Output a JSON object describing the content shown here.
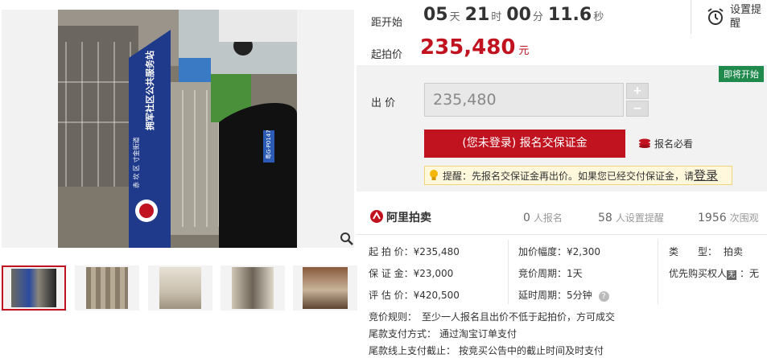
{
  "gallery": {
    "thumbnails": [
      "thumb-1",
      "thumb-2",
      "thumb-3",
      "thumb-4",
      "thumb-5"
    ],
    "zoom_icon": "magnifier-icon",
    "photo_sign_top": "拥军社区公共服务站",
    "photo_sign_left": "赤 坎 区 寸金街道",
    "photo_plate": "粤G·P0147"
  },
  "countdown": {
    "label": "距开始",
    "days": "05",
    "days_unit": "天",
    "hours": "21",
    "hours_unit": "时",
    "minutes": "00",
    "minutes_unit": "分",
    "seconds": "11.6",
    "seconds_unit": "秒"
  },
  "remind": {
    "label": "设置提醒",
    "icon": "alarm-clock-icon"
  },
  "start_price": {
    "label": "起拍价",
    "value": "235,480",
    "unit": "元"
  },
  "bid": {
    "label": "出 价",
    "value": "235,480",
    "plus": "+",
    "minus": "−",
    "status_badge": "即将开始",
    "pay_button": "(您未登录) 报名交保证金",
    "must_read": "报名必看",
    "notice_text": "提醒：先报名交保证金再出价。如果您已经交付保证金，请",
    "notice_login": "登录"
  },
  "stats": {
    "platform": "阿里拍卖",
    "signups_n": "0",
    "signups_label": "人报名",
    "reminders_n": "58",
    "reminders_label": "人设置提醒",
    "views_n": "1956",
    "views_label": "次围观"
  },
  "details": {
    "start_price": {
      "k": "起 拍 价：",
      "v": "¥235,480"
    },
    "deposit": {
      "k": "保 证 金：",
      "v": "¥23,000"
    },
    "appraisal": {
      "k": "评 估 价：",
      "v": "¥420,500"
    },
    "increment": {
      "k": "加价幅度：",
      "v": "¥2,300"
    },
    "cycle": {
      "k": "竞价周期：",
      "v": "1天"
    },
    "delay": {
      "k": "延时周期：",
      "v": "5分钟"
    },
    "type": {
      "k": "类　　型：",
      "v": "拍卖"
    },
    "priority": {
      "k": "优先购买权人",
      "badge": "无",
      "v": "：无"
    },
    "rule": {
      "k": "竞价规则：",
      "v": "至少一人报名且出价不低于起拍价，方可成交"
    },
    "pay_method": {
      "k": "尾款支付方式：",
      "v": "通过淘宝订单支付"
    },
    "pay_deadline": {
      "k": "尾款线上支付截止：",
      "v": "按竞买公告中的截止时间及时支付"
    }
  }
}
